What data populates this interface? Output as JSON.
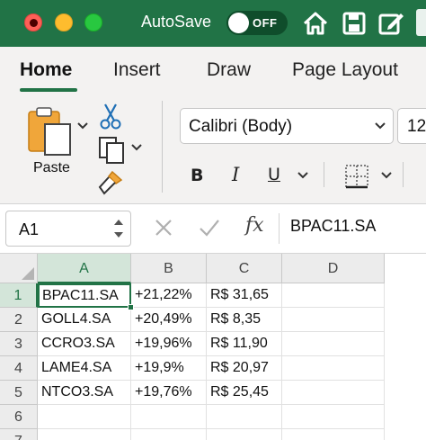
{
  "titlebar": {
    "autosave_label": "AutoSave",
    "autosave_state": "OFF",
    "accent_color": "#217346",
    "icons": [
      "home-icon",
      "save-icon",
      "edit-icon"
    ]
  },
  "tabs": [
    {
      "label": "Home",
      "active": true
    },
    {
      "label": "Insert",
      "active": false
    },
    {
      "label": "Draw",
      "active": false
    },
    {
      "label": "Page Layout",
      "active": false
    }
  ],
  "ribbon": {
    "paste_label": "Paste",
    "font_name": "Calibri (Body)",
    "font_size": "12",
    "bold_label": "B",
    "italic_label": "I",
    "underline_label": "U"
  },
  "formula_bar": {
    "cell_ref": "A1",
    "fx_label": "fx",
    "formula": "BPAC11.SA"
  },
  "grid": {
    "columns": [
      "A",
      "B",
      "C",
      "D"
    ],
    "rows": [
      {
        "num": "1",
        "cells": [
          "BPAC11.SA",
          "+21,22%",
          "R$ 31,65",
          ""
        ]
      },
      {
        "num": "2",
        "cells": [
          "GOLL4.SA",
          "+20,49%",
          "R$ 8,35",
          ""
        ]
      },
      {
        "num": "3",
        "cells": [
          "CCRO3.SA",
          "+19,96%",
          "R$ 11,90",
          ""
        ]
      },
      {
        "num": "4",
        "cells": [
          "LAME4.SA",
          "+19,9%",
          "R$ 20,97",
          ""
        ]
      },
      {
        "num": "5",
        "cells": [
          "NTCO3.SA",
          "+19,76%",
          "R$ 25,45",
          ""
        ]
      },
      {
        "num": "6",
        "cells": [
          "",
          "",
          "",
          ""
        ]
      },
      {
        "num": "7",
        "cells": [
          "",
          "",
          "",
          ""
        ]
      }
    ],
    "active_cell": "A1"
  }
}
